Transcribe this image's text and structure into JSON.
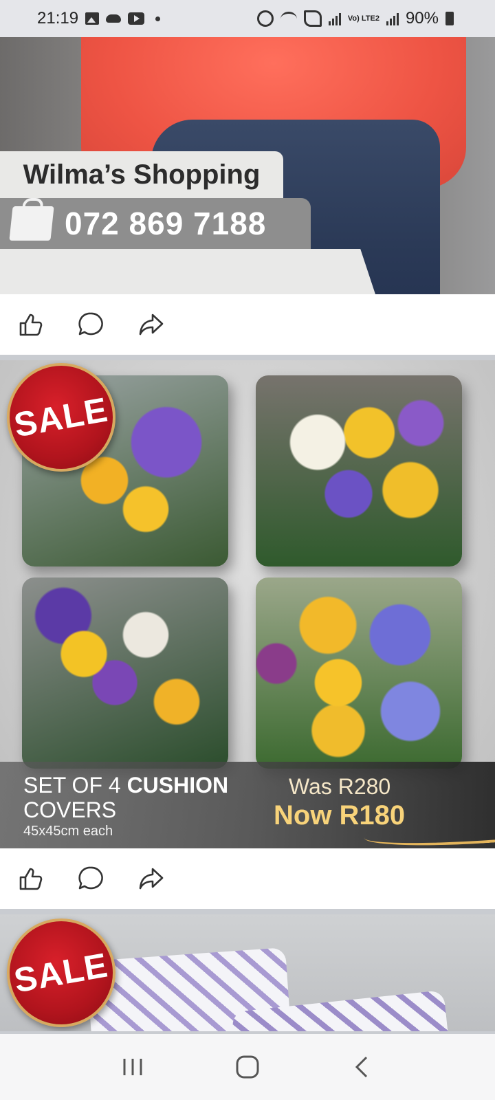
{
  "status_bar": {
    "time": "21:19",
    "battery": "90%",
    "network_label": "Vo) LTE2",
    "icons": [
      "image-icon",
      "cloud-icon",
      "youtube-icon",
      "notification-dot-icon",
      "alarm-icon",
      "wifi-icon",
      "wifi-call-icon",
      "signal-icon",
      "battery-icon"
    ]
  },
  "posts": [
    {
      "banner_name": "Wilma’s Shopping",
      "phone": "072 869 7188",
      "actions": [
        "like-icon",
        "comment-icon",
        "share-icon"
      ]
    },
    {
      "badge": "SALE",
      "title_plain": "SET OF 4 ",
      "title_bold": "CUSHION",
      "title_line2": "COVERS",
      "size": "45x45cm each",
      "was_price": "Was R280",
      "now_price": "Now R180",
      "actions": [
        "like-icon",
        "comment-icon",
        "share-icon"
      ]
    },
    {
      "badge": "SALE"
    }
  ],
  "nav_bar": {
    "buttons": [
      "recent-apps-icon",
      "home-icon",
      "back-icon"
    ]
  },
  "colors": {
    "sale_red": "#b1141d",
    "price_gold": "#f8d37a",
    "sweater": "#ee5444"
  }
}
